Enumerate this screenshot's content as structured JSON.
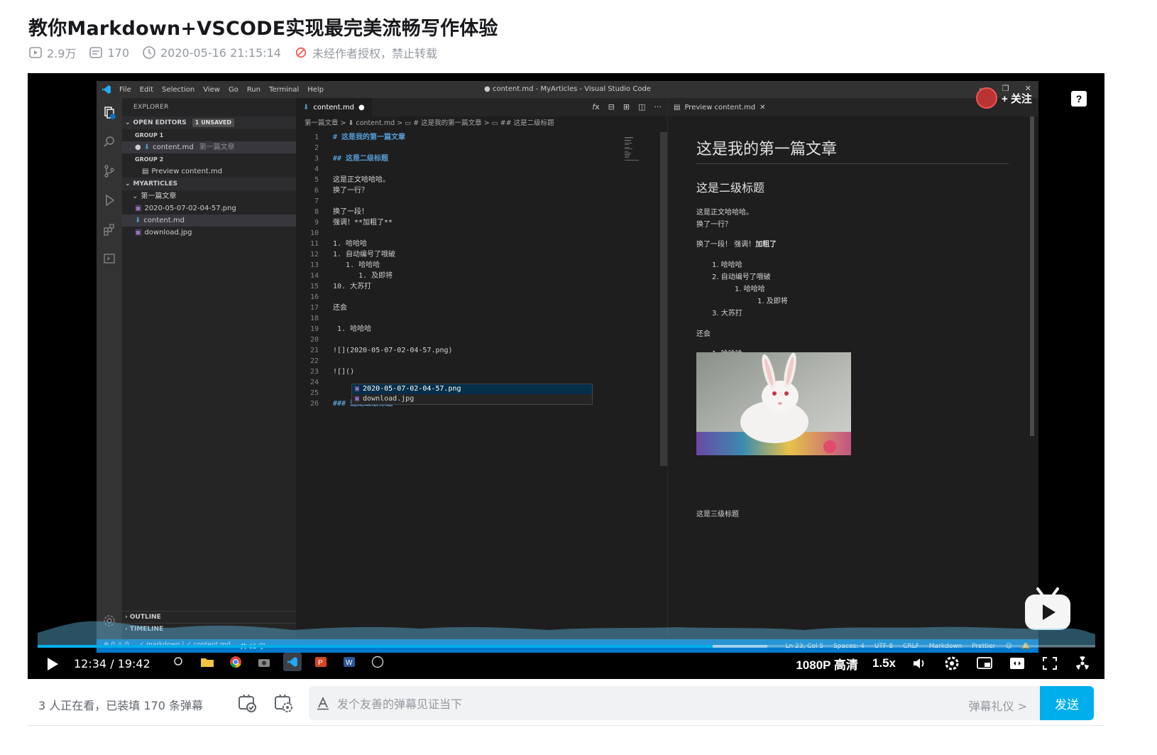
{
  "video": {
    "title": "教你Markdown+VSCODE实现最完美流畅写作体验",
    "views": "2.9万",
    "danmaku_count": "170",
    "published": "2020-05-16 21:15:14",
    "copyright_notice": "未经作者授权，禁止转载"
  },
  "vscode": {
    "menu": [
      "File",
      "Edit",
      "Selection",
      "View",
      "Go",
      "Run",
      "Terminal",
      "Help"
    ],
    "window_title": "● content.md - MyArticles - Visual Studio Code",
    "sidebar": {
      "header": "EXPLORER",
      "open_editors": "OPEN EDITORS",
      "unsaved_badge": "1 UNSAVED",
      "group1": "GROUP 1",
      "group1_item": "content.md",
      "group1_item_folder": "第一篇文章",
      "group2": "GROUP 2",
      "group2_item": "Preview content.md",
      "workspace": "MYARTICLES",
      "folder": "第一篇文章",
      "files": [
        "2020-05-07-02-04-57.png",
        "content.md",
        "download.jpg"
      ],
      "outline": "OUTLINE",
      "timeline": "TIMELINE"
    },
    "editor": {
      "tab": "content.md",
      "breadcrumb": "第一篇文章 > ⬇ content.md > ▭ # 这是我的第一篇文章 > ▭ ## 这是二级标题",
      "lines": [
        {
          "n": "1",
          "t": "# 这是我的第一篇文章"
        },
        {
          "n": "2",
          "t": ""
        },
        {
          "n": "3",
          "t": "## 这是二级标题"
        },
        {
          "n": "4",
          "t": ""
        },
        {
          "n": "5",
          "t": "这是正文哈哈哈。"
        },
        {
          "n": "6",
          "t": "换了一行？"
        },
        {
          "n": "7",
          "t": ""
        },
        {
          "n": "8",
          "t": "换了一段！"
        },
        {
          "n": "9",
          "t": "强调！**加粗了**"
        },
        {
          "n": "10",
          "t": ""
        },
        {
          "n": "11",
          "t": "1. 哈哈哈"
        },
        {
          "n": "12",
          "t": "1. 自动编号了哦破"
        },
        {
          "n": "13",
          "t": "   1. 哈哈哈"
        },
        {
          "n": "14",
          "t": "      1. 及即将"
        },
        {
          "n": "15",
          "t": "10. 大苏打"
        },
        {
          "n": "16",
          "t": ""
        },
        {
          "n": "17",
          "t": "还会"
        },
        {
          "n": "18",
          "t": ""
        },
        {
          "n": "19",
          "t": " 1. 哈哈哈"
        },
        {
          "n": "20",
          "t": ""
        },
        {
          "n": "21",
          "t": "![](2020-05-07-02-04-57.png)"
        },
        {
          "n": "22",
          "t": ""
        },
        {
          "n": "23",
          "t": "![]()"
        },
        {
          "n": "24",
          "t": ""
        },
        {
          "n": "25",
          "t": ""
        },
        {
          "n": "26",
          "t": "### 这是三级标题"
        }
      ],
      "suggestions": [
        "2020-05-07-02-04-57.png",
        "download.jpg"
      ]
    },
    "preview": {
      "tab": "Preview content.md",
      "h1": "这是我的第一篇文章",
      "h2": "这是二级标题",
      "p1": "这是正文哈哈哈。",
      "p1b": "换了一行？",
      "p2": "换了一段！ 强调！",
      "p2_bold": "加粗了",
      "list": [
        {
          "label": "1. 哈哈哈",
          "indent": 0
        },
        {
          "label": "2. 自动编号了哦破",
          "indent": 0
        },
        {
          "label": "1. 哈哈哈",
          "indent": 1
        },
        {
          "label": "1. 及即将",
          "indent": 2
        },
        {
          "label": "3. 大苏打",
          "indent": 0
        }
      ],
      "p3": "还会",
      "list2": "1. 哈哈哈",
      "h3": "这是三级标题"
    },
    "status": {
      "left": [
        "⊗ 0 ⚠ 0",
        "✓ markdown | ✓ content.md",
        "共 65 字"
      ],
      "right": [
        "Ln 23, Col 5",
        "Spaces: 4",
        "UTF-8",
        "CRLF",
        "Markdown",
        "Prettier"
      ]
    }
  },
  "player": {
    "current_time": "12:34",
    "total_time": "19:42",
    "time_display": "12:34 / 19:42",
    "progress_fraction": 0.638,
    "buffer_fraction": 0.69,
    "quality": "1080P 高清",
    "speed": "1.5x",
    "follow_label": "+ 关注",
    "help_label": "?"
  },
  "danmaku": {
    "viewers": "3 人正在看，已装填 170 条弹幕",
    "placeholder": "发个友善的弹幕见证当下",
    "etiquette": "弹幕礼仪 >",
    "send": "发送"
  },
  "colors": {
    "accent": "#00aeec",
    "vscode_status": "#007acc",
    "warning": "#f25d59"
  }
}
